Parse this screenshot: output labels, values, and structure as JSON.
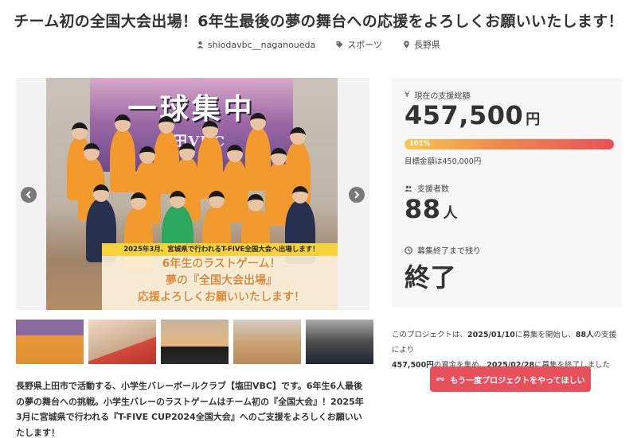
{
  "page": {
    "title": "チーム初の全国大会出場！6年生最後の夢の舞台への応援をよろしくお願いいたします！"
  },
  "meta": {
    "owner": "shiodavbc__naganoueda",
    "category": "スポーツ",
    "location": "長野県"
  },
  "hero": {
    "banner_text": "一球集中",
    "banner_sub": "塩田VBC",
    "caption_strip": "2025年3月、宮城県で行われるT-FIVE全国大会へ出場します！",
    "caption_lines": [
      "6年生のラストゲーム！",
      "夢の『全国大会出場』",
      "応援よろしくお願いいたします！"
    ]
  },
  "stats": {
    "total_label": "現在の支援総額",
    "total_value": "457,500",
    "total_unit": "円",
    "progress_percent": 101,
    "progress_label": "101%",
    "goal_text": "目標金額は450,000円",
    "supporters_label": "支援者数",
    "supporters_value": "88",
    "supporters_unit": "人",
    "remaining_label": "募集終了まで残り",
    "remaining_value": "終了"
  },
  "summary": {
    "p1": "このプロジェクトは、",
    "start_date": "2025/01/10",
    "p2": "に募集を開始し、",
    "supporters": "88人",
    "p3": "の支援により",
    "amount": "457,500円",
    "p4": "の資金を集め、",
    "end_date": "2025/02/28",
    "p5": "に募集を終了しました"
  },
  "cta": {
    "label": "もう一度プロジェクトをやってほしい"
  },
  "description": "長野県上田市で活動する、小学生バレーボールクラブ【塩田VBC】です。6年生6人最後の夢の舞台への挑戦。小学生バレーのラストゲームはチーム初の『全国大会』！2025年3月に宮城県で行われる『T-FIVE CUP2024全国大会』へのご支援をよろしくお願いいたします！",
  "colors": {
    "accent": "#e8505b",
    "progress_start": "#f9c74f",
    "progress_end": "#e8505b",
    "panel_bg": "#f7f7f7"
  }
}
